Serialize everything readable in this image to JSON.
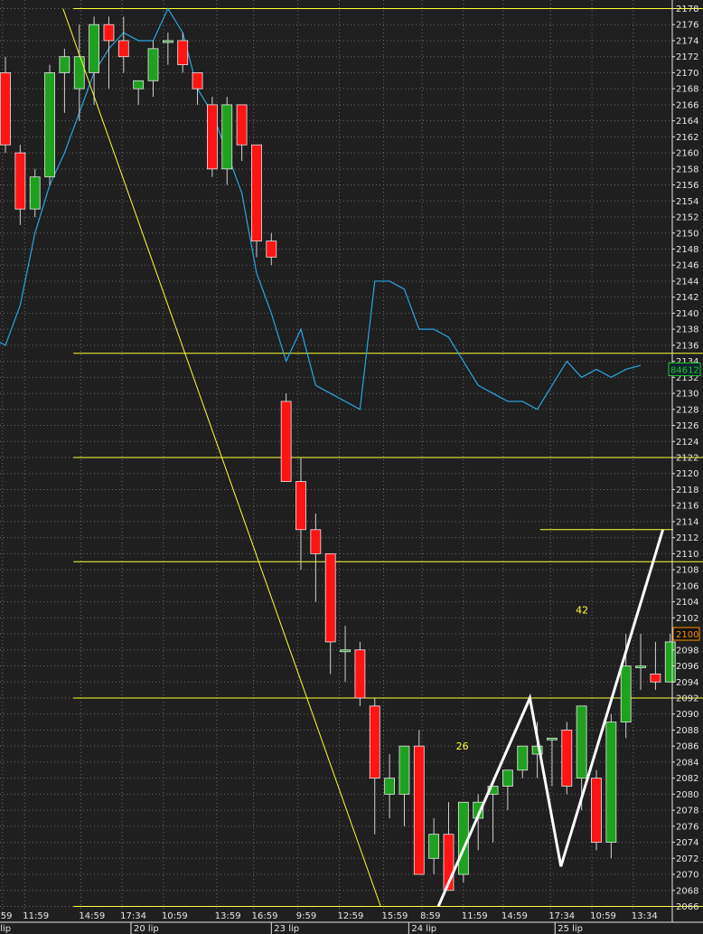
{
  "chart_data": {
    "type": "candlestick",
    "colors": {
      "background": "#1f1f1f",
      "grid": "#6a6a6a",
      "axis_text": "#e6e6e6",
      "bull": "#1fa11f",
      "bear": "#ff1414",
      "wick": "#d0d0d0",
      "indicator_line": "#2aa6e0",
      "yellow": "#ffff33",
      "pattern_line": "#ffffff",
      "last_price_box": "#ff8c00",
      "indicator_box": "#1ec81e"
    },
    "ylim": [
      2066,
      2178
    ],
    "y_ticks": [
      2066,
      2068,
      2070,
      2072,
      2074,
      2076,
      2078,
      2080,
      2082,
      2084,
      2086,
      2088,
      2090,
      2092,
      2094,
      2096,
      2098,
      2100,
      2102,
      2104,
      2106,
      2108,
      2110,
      2112,
      2114,
      2116,
      2118,
      2120,
      2122,
      2124,
      2126,
      2128,
      2130,
      2132,
      2134,
      2136,
      2138,
      2140,
      2142,
      2144,
      2146,
      2148,
      2150,
      2152,
      2154,
      2156,
      2158,
      2160,
      2162,
      2164,
      2166,
      2168,
      2170,
      2172,
      2174,
      2176,
      2178
    ],
    "x_ticks": [
      {
        "i": -0.2,
        "label": "59"
      },
      {
        "i": 1.3,
        "label": "11:59"
      },
      {
        "i": 5.1,
        "label": "14:59"
      },
      {
        "i": 7.9,
        "label": "17:34"
      },
      {
        "i": 10.7,
        "label": "10:59"
      },
      {
        "i": 14.3,
        "label": "13:59"
      },
      {
        "i": 16.8,
        "label": "16:59"
      },
      {
        "i": 19.8,
        "label": "9:59"
      },
      {
        "i": 22.6,
        "label": "12:59"
      },
      {
        "i": 25.6,
        "label": "15:59"
      },
      {
        "i": 28.2,
        "label": "8:59"
      },
      {
        "i": 31.0,
        "label": "11:59"
      },
      {
        "i": 33.7,
        "label": "14:59"
      },
      {
        "i": 36.9,
        "label": "17:34"
      },
      {
        "i": 39.7,
        "label": "10:59"
      },
      {
        "i": 42.5,
        "label": "13:34"
      }
    ],
    "date_labels": [
      {
        "i": -0.9,
        "label": "l lip"
      },
      {
        "i": 8.5,
        "label": "20 lip"
      },
      {
        "i": 18.0,
        "label": "23 lip"
      },
      {
        "i": 27.3,
        "label": "24 lip"
      },
      {
        "i": 37.2,
        "label": "25 lip"
      }
    ],
    "candles": [
      {
        "o": 2170,
        "h": 2172,
        "l": 2160,
        "c": 2161
      },
      {
        "o": 2160,
        "h": 2161,
        "l": 2151,
        "c": 2153
      },
      {
        "o": 2153,
        "h": 2158,
        "l": 2152,
        "c": 2157
      },
      {
        "o": 2157,
        "h": 2171,
        "l": 2156,
        "c": 2170
      },
      {
        "o": 2170,
        "h": 2173,
        "l": 2165,
        "c": 2172
      },
      {
        "o": 2168,
        "h": 2176,
        "l": 2164,
        "c": 2172
      },
      {
        "o": 2170,
        "h": 2177,
        "l": 2166,
        "c": 2176
      },
      {
        "o": 2176,
        "h": 2177,
        "l": 2168,
        "c": 2174
      },
      {
        "o": 2174,
        "h": 2177,
        "l": 2170,
        "c": 2172
      },
      {
        "o": 2168,
        "h": 2169,
        "l": 2166,
        "c": 2169
      },
      {
        "o": 2169,
        "h": 2174,
        "l": 2167,
        "c": 2173
      },
      {
        "o": 2174,
        "h": 2175,
        "l": 2171,
        "c": 2174
      },
      {
        "o": 2174,
        "h": 2175,
        "l": 2170,
        "c": 2171
      },
      {
        "o": 2170,
        "h": 2170,
        "l": 2166,
        "c": 2168
      },
      {
        "o": 2166,
        "h": 2167,
        "l": 2157,
        "c": 2158
      },
      {
        "o": 2158,
        "h": 2167,
        "l": 2156,
        "c": 2166
      },
      {
        "o": 2166,
        "h": 2166,
        "l": 2159,
        "c": 2161
      },
      {
        "o": 2161,
        "h": 2161,
        "l": 2147,
        "c": 2149
      },
      {
        "o": 2149,
        "h": 2150,
        "l": 2146,
        "c": 2147
      },
      {
        "o": 2129,
        "h": 2130,
        "l": 2119,
        "c": 2119
      },
      {
        "o": 2119,
        "h": 2122,
        "l": 2108,
        "c": 2113
      },
      {
        "o": 2113,
        "h": 2115,
        "l": 2104,
        "c": 2110
      },
      {
        "o": 2110,
        "h": 2110,
        "l": 2095,
        "c": 2099
      },
      {
        "o": 2098,
        "h": 2101,
        "l": 2094,
        "c": 2098
      },
      {
        "o": 2098,
        "h": 2099,
        "l": 2091,
        "c": 2092
      },
      {
        "o": 2091,
        "h": 2092,
        "l": 2075,
        "c": 2082
      },
      {
        "o": 2080,
        "h": 2085,
        "l": 2077,
        "c": 2082
      },
      {
        "o": 2080,
        "h": 2086,
        "l": 2076,
        "c": 2086
      },
      {
        "o": 2086,
        "h": 2088,
        "l": 2070,
        "c": 2070
      },
      {
        "o": 2072,
        "h": 2077,
        "l": 2070,
        "c": 2075
      },
      {
        "o": 2075,
        "h": 2079,
        "l": 2068,
        "c": 2068
      },
      {
        "o": 2070,
        "h": 2078,
        "l": 2069,
        "c": 2079
      },
      {
        "o": 2077,
        "h": 2080,
        "l": 2073,
        "c": 2079
      },
      {
        "o": 2080,
        "h": 2081,
        "l": 2074,
        "c": 2081
      },
      {
        "o": 2081,
        "h": 2083,
        "l": 2078,
        "c": 2083
      },
      {
        "o": 2083,
        "h": 2086,
        "l": 2082,
        "c": 2086
      },
      {
        "o": 2085,
        "h": 2089,
        "l": 2082,
        "c": 2086
      },
      {
        "o": 2087,
        "h": 2087,
        "l": 2081,
        "c": 2087
      },
      {
        "o": 2088,
        "h": 2089,
        "l": 2080,
        "c": 2081
      },
      {
        "o": 2082,
        "h": 2091,
        "l": 2078,
        "c": 2091
      },
      {
        "o": 2082,
        "h": 2083,
        "l": 2073,
        "c": 2074
      },
      {
        "o": 2074,
        "h": 2090,
        "l": 2072,
        "c": 2089
      },
      {
        "o": 2089,
        "h": 2100,
        "l": 2087,
        "c": 2096
      },
      {
        "o": 2096,
        "h": 2100,
        "l": 2093,
        "c": 2096
      },
      {
        "o": 2095,
        "h": 2099,
        "l": 2093,
        "c": 2094
      },
      {
        "o": 2094,
        "h": 2100,
        "l": 2094,
        "c": 2099
      }
    ],
    "indicator_line": {
      "x": [
        -1.8,
        -0.8,
        0,
        1,
        2,
        3,
        4,
        5,
        6,
        7,
        8,
        9,
        10,
        11,
        12,
        13,
        14,
        15,
        16,
        17,
        18,
        19,
        20,
        21,
        22,
        23,
        24,
        25,
        26,
        27,
        28,
        29,
        30,
        31,
        32,
        33,
        34,
        35,
        36,
        37,
        38,
        39,
        40,
        41,
        42,
        43
      ],
      "y": [
        2137,
        2136.8,
        2136,
        2141,
        2150,
        2156,
        2160,
        2165,
        2170,
        2173,
        2175,
        2174,
        2174,
        2178,
        2175,
        2168,
        2165,
        2160,
        2155,
        2145,
        2140,
        2134,
        2138,
        2131,
        2130,
        2129,
        2128,
        2144,
        2144,
        2143,
        2138,
        2138,
        2137,
        2134,
        2131,
        2130,
        2129,
        2129,
        2128,
        2131,
        2134,
        2132,
        2133,
        2132,
        2133,
        2133.5
      ]
    },
    "price_box": {
      "label": "2100",
      "value": 2100
    },
    "indicator_box": {
      "label": "84612",
      "value": 2133
    },
    "horizontal_lines": [
      2135,
      2122,
      2109,
      2092,
      2066
    ],
    "short_horizontal_line": {
      "value": 2113,
      "i_start": 36.2,
      "i_end": 45.2
    },
    "yellow_diagonal": {
      "start": {
        "i": 3.9,
        "value": 2178
      },
      "end": {
        "i": 25.4,
        "value": 2066
      }
    },
    "pattern_lines": [
      {
        "points": [
          {
            "i": 29.3,
            "value": 2066
          },
          {
            "i": 35.5,
            "value": 2092
          },
          {
            "i": 37.6,
            "value": 2071
          },
          {
            "i": 44.5,
            "value": 2113
          }
        ]
      }
    ],
    "annotations": [
      {
        "label": "26",
        "i": 30.5,
        "value": 2086
      },
      {
        "label": "42",
        "i": 38.6,
        "value": 2103
      }
    ]
  }
}
